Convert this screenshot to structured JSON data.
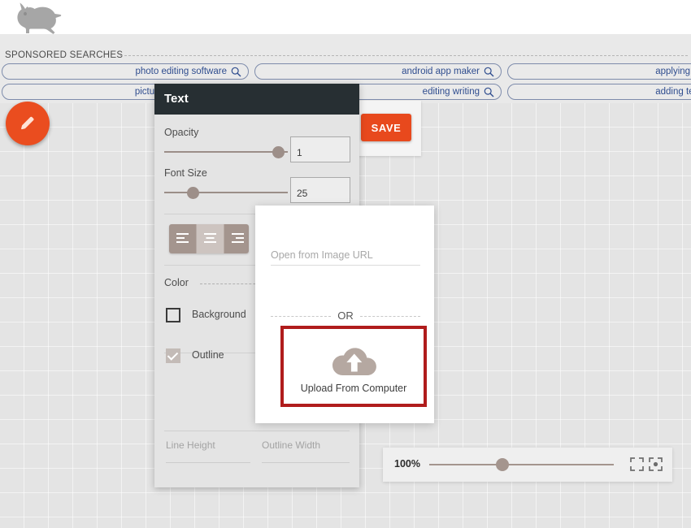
{
  "app": {
    "logo_icon": "bear-logo-icon"
  },
  "ads": {
    "section_label": "SPONSORED SEARCHES",
    "search_icon": "magnifier-icon",
    "row1": [
      {
        "text": "photo editing software",
        "has_icon": true
      },
      {
        "text": "android app maker",
        "has_icon": true
      },
      {
        "text": "applying for passport",
        "has_icon": false
      }
    ],
    "row2": [
      {
        "text": "picture editor software",
        "has_icon": true
      },
      {
        "text": "editing writing",
        "has_icon": true
      },
      {
        "text": "adding text to photos",
        "has_icon": false
      }
    ]
  },
  "toolbar": {
    "edit_fab_icon": "pencil-icon",
    "save_label": "SAVE"
  },
  "text_panel": {
    "title": "Text",
    "opacity": {
      "label": "Opacity",
      "value": "1",
      "thumb_position_pct": 95
    },
    "font_size": {
      "label": "Font Size",
      "value": "25",
      "thumb_position_pct": 26
    },
    "alignment": {
      "options": [
        "align-left-icon",
        "align-center-icon",
        "align-right-icon"
      ],
      "selected_index": 1
    },
    "color_label": "Color",
    "checkboxes": [
      {
        "label": "Background",
        "checked": false,
        "icon": "checkbox-unchecked-icon"
      },
      {
        "label": "Outline",
        "checked": true,
        "icon": "checkbox-checked-icon"
      }
    ],
    "line_height_label": "Line Height",
    "line_height_value": "",
    "outline_width_label": "Outline Width",
    "outline_width_value": ""
  },
  "upload_dialog": {
    "url_placeholder": "Open from Image URL",
    "url_value": "",
    "or_text": "OR",
    "upload_label": "Upload From Computer",
    "upload_icon": "cloud-upload-icon",
    "highlight_color": "#b01c1c"
  },
  "zoom_bar": {
    "percent_label": "100%",
    "slider_position_pct": 36,
    "fit_icon": "fit-to-screen-icon",
    "focus_icon": "focus-center-icon"
  },
  "colors": {
    "accent_orange": "#e8491d",
    "panel_header_dark": "#272f33",
    "slider_brown": "#a4958e",
    "ad_link_blue": "#2f4d8f",
    "canvas_gray": "#e4e4e4"
  }
}
